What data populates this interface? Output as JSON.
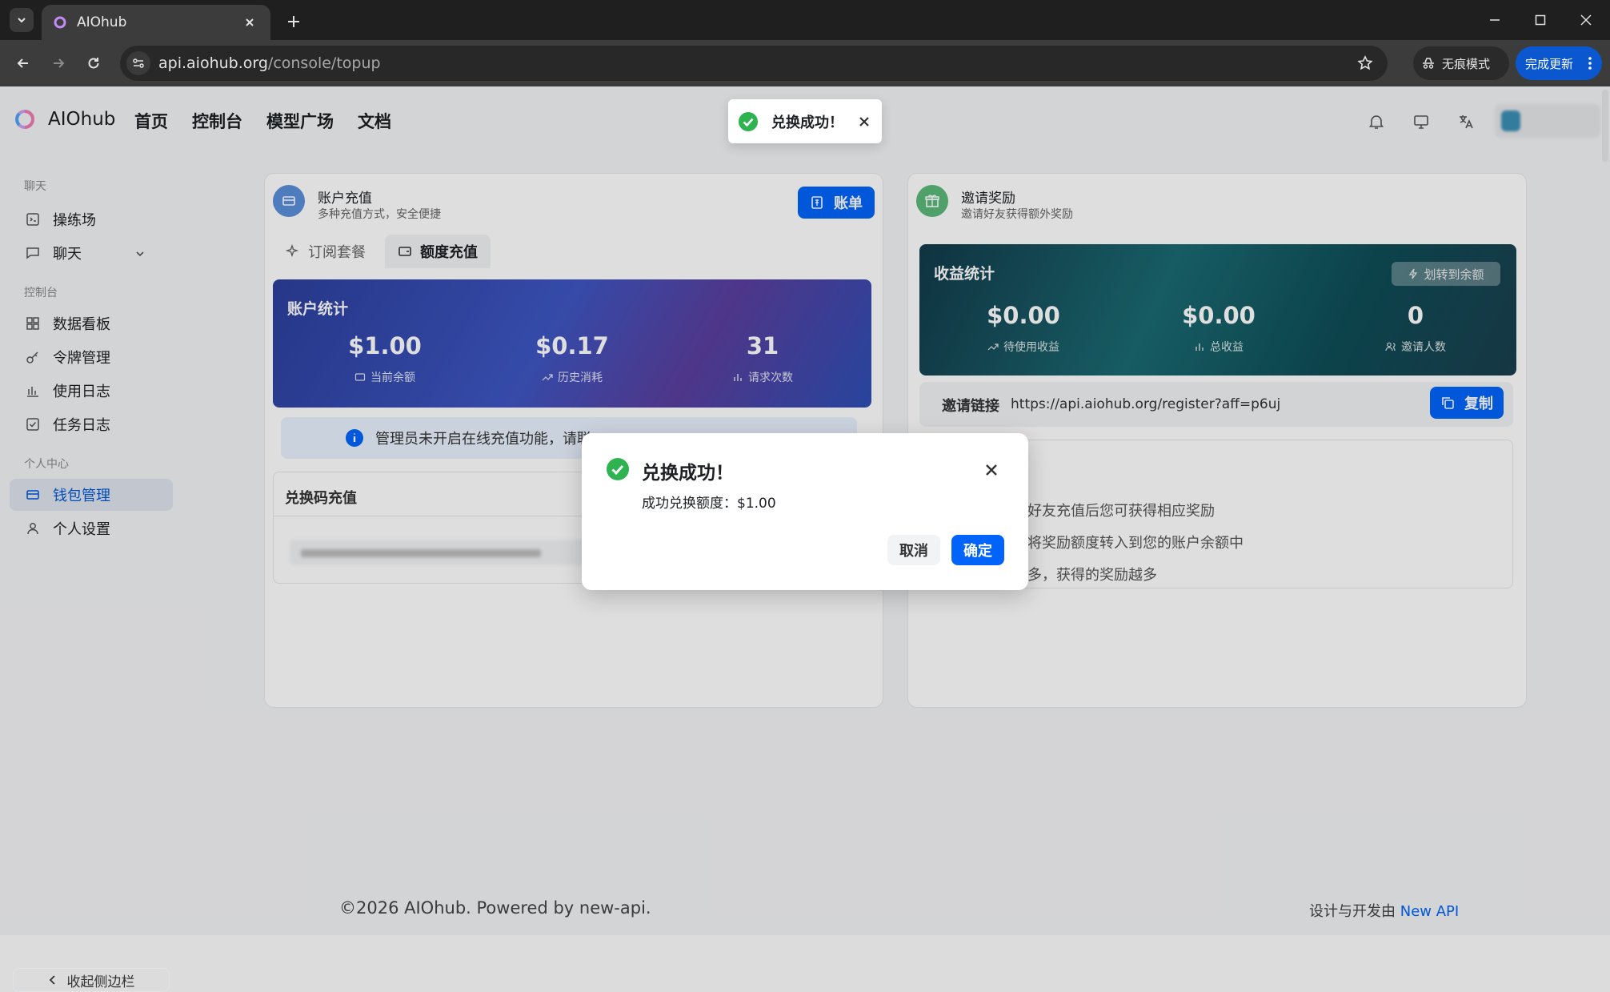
{
  "browser": {
    "tab_title": "AIOhub",
    "url_host": "api.aiohub.org",
    "url_path": "/console/topup",
    "incognito_label": "无痕模式",
    "update_label": "完成更新"
  },
  "app": {
    "brand": "AIOhub",
    "nav": [
      "首页",
      "控制台",
      "模型广场",
      "文档"
    ]
  },
  "sidebar": {
    "groups": [
      "聊天",
      "控制台",
      "个人中心"
    ],
    "items": [
      "操练场",
      "聊天",
      "数据看板",
      "令牌管理",
      "使用日志",
      "任务日志",
      "钱包管理",
      "个人设置"
    ],
    "collapse_label": "收起侧边栏"
  },
  "topup": {
    "title": "账户充值",
    "subtitle": "多种充值方式，安全便捷",
    "bill_button": "账单",
    "tabs": [
      "订阅套餐",
      "额度充值"
    ],
    "stats_title": "账户统计",
    "stats": [
      {
        "value": "$1.00",
        "label": "当前余额"
      },
      {
        "value": "$0.17",
        "label": "历史消耗"
      },
      {
        "value": "31",
        "label": "请求次数"
      }
    ],
    "notice": "管理员未开启在线充值功能，请联",
    "redeem_title": "兑换码充值"
  },
  "invite": {
    "title": "邀请奖励",
    "subtitle": "邀请好友获得额外奖励",
    "stats_title": "收益统计",
    "transfer_button": "划转到余额",
    "stats": [
      {
        "value": "$0.00",
        "label": "待使用收益"
      },
      {
        "value": "$0.00",
        "label": "总收益"
      },
      {
        "value": "0",
        "label": "邀请人数"
      }
    ],
    "link_label": "邀请链接",
    "link_url": "https://api.aiohub.org/register?aff=p6uj",
    "copy_button": "复制",
    "rules": [
      "，好友充值后您可获得相应奖励",
      "将奖励额度转入到您的账户余额中",
      "多，获得的奖励越多"
    ]
  },
  "footer": {
    "copyright": "©2026 AIOhub. Powered by new-api.",
    "credit_prefix": "设计与开发由",
    "credit_link": "New API"
  },
  "toast": {
    "text": "兑换成功！"
  },
  "modal": {
    "title": "兑换成功！",
    "body": "成功兑换额度：$1.00",
    "cancel": "取消",
    "ok": "确定"
  }
}
